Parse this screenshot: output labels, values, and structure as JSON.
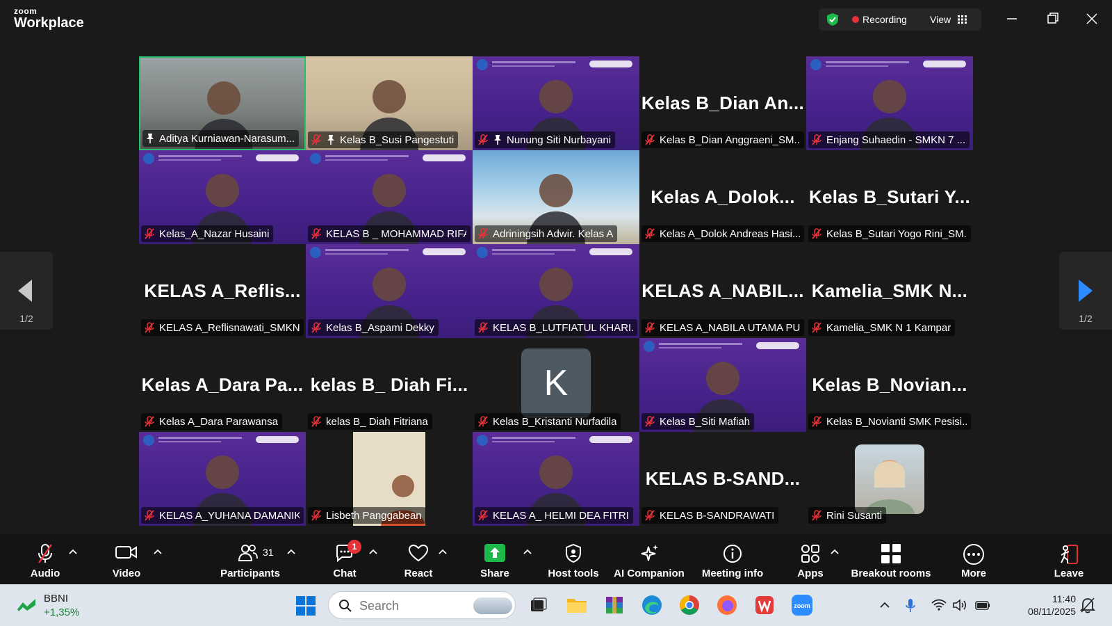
{
  "app": {
    "logo_line1": "zoom",
    "logo_line2": "Workplace"
  },
  "titlebar": {
    "recording_label": "Recording",
    "view_label": "View"
  },
  "tiles": [
    {
      "name": "Aditya Kurniawan-Narasum...",
      "big": "",
      "style": "photo1",
      "pin": true,
      "muted": false,
      "active": true
    },
    {
      "name": "Kelas B_Susi Pangestuti",
      "big": "",
      "style": "photo2",
      "pin": true,
      "muted": true
    },
    {
      "name": "Nunung Siti Nurbayani",
      "big": "",
      "style": "purple",
      "pin": true,
      "muted": true
    },
    {
      "name": "Kelas B_Dian Anggraeni_SM...",
      "big": "Kelas B_Dian An...",
      "style": "black",
      "muted": true
    },
    {
      "name": "Enjang Suhaedin - SMKN 7 ...",
      "big": "",
      "style": "purple",
      "muted": true
    },
    {
      "name": "Kelas_A_Nazar Husaini",
      "big": "",
      "style": "purple",
      "muted": true
    },
    {
      "name": "KELAS B _ MOHAMMAD RIFAI",
      "big": "",
      "style": "purple",
      "muted": true
    },
    {
      "name": "Adriningsih Adwir. Kelas A",
      "big": "",
      "style": "beach",
      "muted": true
    },
    {
      "name": "Kelas A_Dolok Andreas Hasi...",
      "big": "Kelas A_Dolok...",
      "style": "black",
      "muted": true
    },
    {
      "name": "Kelas B_Sutari Yogo Rini_SM...",
      "big": "Kelas B_Sutari Y...",
      "style": "black",
      "muted": true
    },
    {
      "name": "KELAS A_Reflisnawati_SMKN...",
      "big": "KELAS A_Reflis...",
      "style": "black",
      "muted": true
    },
    {
      "name": "Kelas B_Aspami Dekky",
      "big": "",
      "style": "purple",
      "muted": true
    },
    {
      "name": "KELAS B_LUTFIATUL KHARI...",
      "big": "",
      "style": "purple",
      "muted": true
    },
    {
      "name": "KELAS A_NABILA UTAMA PU...",
      "big": "KELAS A_NABIL...",
      "style": "black",
      "muted": true
    },
    {
      "name": "Kamelia_SMK N 1 Kampar",
      "big": "Kamelia_SMK N...",
      "style": "black",
      "muted": true
    },
    {
      "name": "Kelas A_Dara Parawansa",
      "big": "Kelas A_Dara Pa...",
      "style": "black",
      "muted": true
    },
    {
      "name": "kelas B_ Diah Fitriana",
      "big": "kelas B_ Diah Fi...",
      "style": "black",
      "muted": true
    },
    {
      "name": "Kelas B_Kristanti Nurfadila",
      "big": "",
      "avatar": "K",
      "style": "black",
      "muted": true
    },
    {
      "name": "Kelas B_Siti Mafiah",
      "big": "",
      "style": "purple",
      "muted": true
    },
    {
      "name": "Kelas B_Novianti SMK Pesisi...",
      "big": "Kelas B_Novian...",
      "style": "black",
      "muted": true
    },
    {
      "name": "KELAS A_YUHANA DAMANIK",
      "big": "",
      "style": "purple",
      "muted": true
    },
    {
      "name": "Lisbeth Panggabean",
      "big": "",
      "style": "black",
      "muted": true
    },
    {
      "name": "KELAS A_ HELMI DEA FITRI",
      "big": "",
      "style": "purple",
      "muted": true
    },
    {
      "name": "KELAS B-SANDRAWATI",
      "big": "KELAS B-SAND...",
      "style": "black",
      "muted": true
    },
    {
      "name": "Rini Susanti",
      "big": "",
      "style": "black",
      "muted": true
    }
  ],
  "pager": {
    "left_page": "1/2",
    "right_page": "1/2"
  },
  "toolbar": {
    "audio": "Audio",
    "video": "Video",
    "participants": "Participants",
    "participants_count": "31",
    "chat": "Chat",
    "chat_badge": "1",
    "react": "React",
    "share": "Share",
    "host_tools": "Host tools",
    "ai_companion": "AI Companion",
    "meeting_info": "Meeting info",
    "apps": "Apps",
    "breakout_rooms": "Breakout rooms",
    "more": "More",
    "leave": "Leave"
  },
  "taskbar": {
    "stock_name": "BBNI",
    "stock_change": "+1,35%",
    "search_placeholder": "Search",
    "time": "11:40",
    "date": "08/11/2025"
  },
  "colors": {
    "accent_green": "#27c16b",
    "record_red": "#e8323a",
    "share_green": "#1fb84a",
    "tile_purple": "#4a2590"
  }
}
